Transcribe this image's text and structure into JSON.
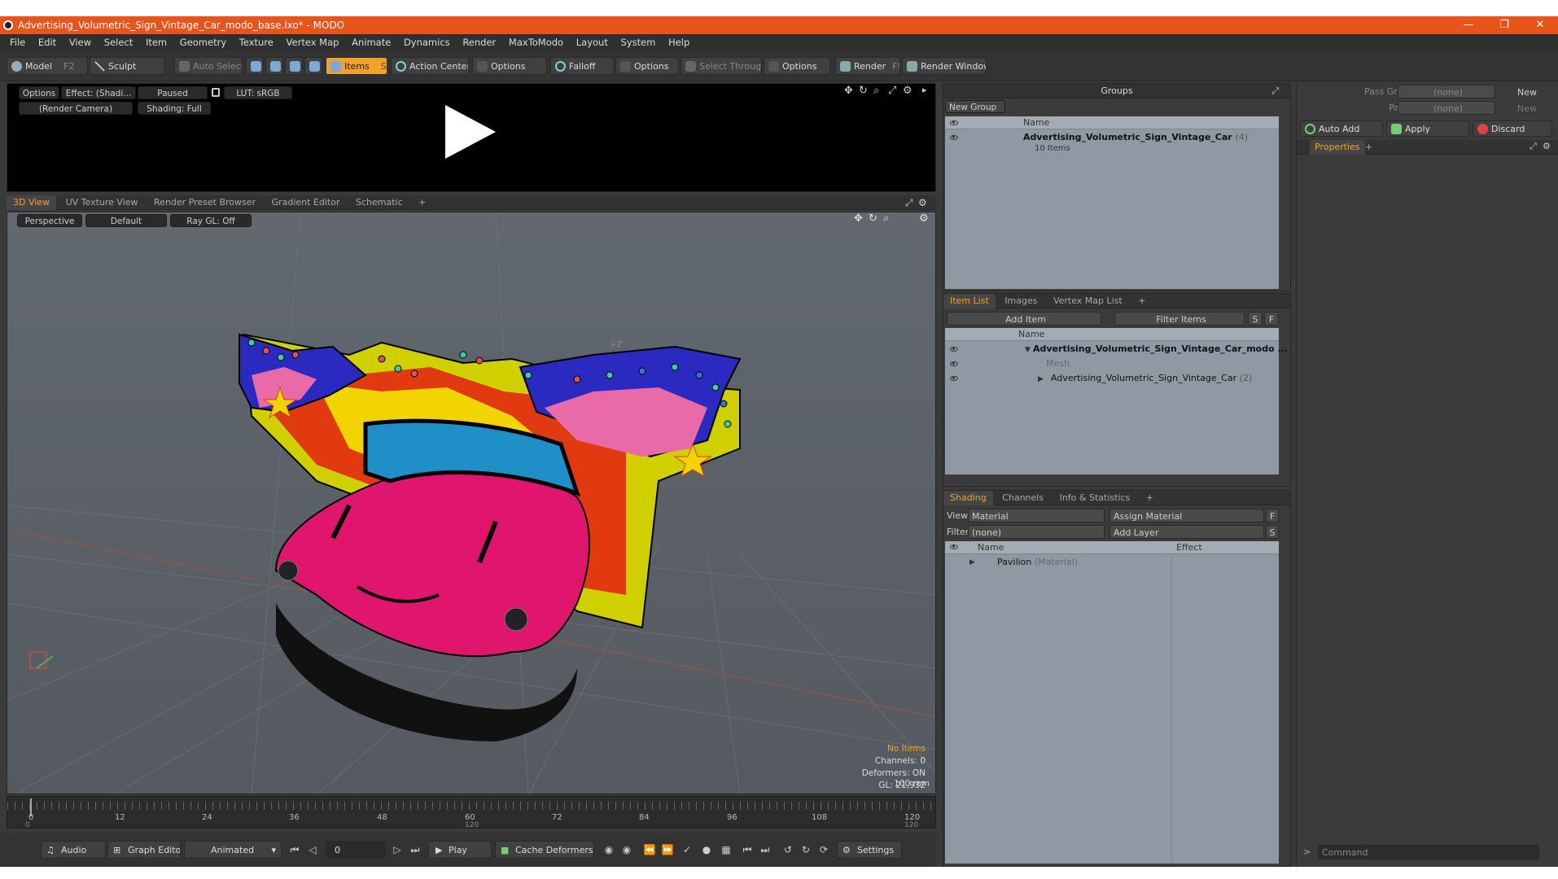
{
  "window": {
    "title": "Advertising_Volumetric_Sign_Vintage_Car_modo_base.lxo* - MODO",
    "minimize": "—",
    "restore": "❐",
    "close": "✕"
  },
  "menu": [
    "File",
    "Edit",
    "View",
    "Select",
    "Item",
    "Geometry",
    "Texture",
    "Vertex Map",
    "Animate",
    "Dynamics",
    "Render",
    "MaxToModo",
    "Layout",
    "System",
    "Help"
  ],
  "toolbar": {
    "model": "Model",
    "model_key": "F2",
    "sculpt": "Sculpt",
    "auto_select": "Auto Select",
    "items": "Items",
    "items_key": "S",
    "action_center": "Action Center",
    "options1": "Options",
    "falloff": "Falloff",
    "options2": "Options",
    "select_through": "Select Through",
    "options3": "Options",
    "render": "Render",
    "render_key": "F9",
    "render_window": "Render Window"
  },
  "preview": {
    "options": "Options",
    "effect": "Effect: (Shadi...",
    "paused": "Paused",
    "lut": "LUT: sRGB",
    "camera": "(Render Camera)",
    "shading": "Shading: Full"
  },
  "viewport_tabs": [
    "3D View",
    "UV Texture View",
    "Render Preset Browser",
    "Gradient Editor",
    "Schematic",
    "+"
  ],
  "viewport": {
    "perspective": "Perspective",
    "default": "Default",
    "raygl": "Ray GL: Off",
    "axis_label": "+Z",
    "stats": {
      "items": "No Items",
      "channels": "Channels: 0",
      "deformers": "Deformers: ON",
      "gl": "GL: 21,932",
      "scale": "100 mm"
    }
  },
  "timeline": {
    "ticks": [
      "0",
      "12",
      "24",
      "36",
      "48",
      "60",
      "72",
      "84",
      "96",
      "108",
      "120"
    ],
    "sub_ticks": [
      "0",
      "120",
      "120"
    ]
  },
  "bottombar": {
    "audio": "Audio",
    "graph_editor": "Graph Editor",
    "animated": "Animated",
    "frame": "0",
    "play": "Play",
    "cache": "Cache Deformers",
    "settings": "Settings"
  },
  "groups": {
    "title": "Groups",
    "new_group": "New Group",
    "col_name": "Name",
    "item_name": "Advertising_Volumetric_Sign_Vintage_Car",
    "item_count": "(4)",
    "item_sub": "10 Items"
  },
  "itemlist": {
    "tabs": [
      "Item List",
      "Images",
      "Vertex Map List",
      "+"
    ],
    "add_item": "Add Item",
    "filter": "Filter Items",
    "s": "S",
    "f": "F",
    "col_name": "Name",
    "rows": [
      {
        "label": "Advertising_Volumetric_Sign_Vintage_Car_modo ...",
        "extra": ""
      },
      {
        "label": "Mesh",
        "extra": ""
      },
      {
        "label": "Advertising_Volumetric_Sign_Vintage_Car",
        "extra": "(2)"
      }
    ]
  },
  "shading": {
    "tabs": [
      "Shading",
      "Channels",
      "Info & Statistics",
      "+"
    ],
    "view_label": "View",
    "view_value": "Material",
    "assign": "Assign Material",
    "f": "F",
    "filter_label": "Filter",
    "filter_value": "(none)",
    "add_layer": "Add Layer",
    "s": "S",
    "col_name": "Name",
    "col_effect": "Effect",
    "row_name": "Pavilion",
    "row_type": "(Material)"
  },
  "properties": {
    "pass_groups": "Pass Groups",
    "pass_groups_value": "(none)",
    "new1": "New",
    "passes": "Passes",
    "passes_value": "(none)",
    "new2": "New",
    "auto_add": "Auto Add",
    "apply": "Apply",
    "discard": "Discard",
    "tab": "Properties",
    "plus": "+",
    "command": "Command"
  },
  "colors": {
    "accent": "#f2a12a",
    "titlebar": "#e8541a",
    "car": "#e0156e",
    "windshield": "#1f8fc8"
  }
}
